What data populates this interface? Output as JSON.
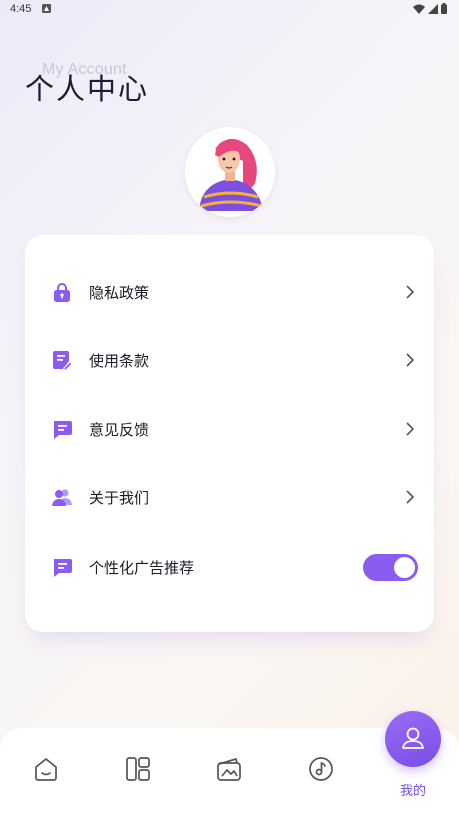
{
  "status_bar": {
    "time": "4:45"
  },
  "header": {
    "subtitle": "My Account",
    "title": "个人中心"
  },
  "menu": [
    {
      "label": "隐私政策",
      "icon": "lock-icon"
    },
    {
      "label": "使用条款",
      "icon": "document-edit-icon"
    },
    {
      "label": "意见反馈",
      "icon": "chat-feedback-icon"
    },
    {
      "label": "关于我们",
      "icon": "users-icon"
    }
  ],
  "personalized_ads": {
    "label": "个性化广告推荐",
    "icon": "chat-icon",
    "enabled": true
  },
  "tabs": {
    "items": [
      "home-icon",
      "layout-icon",
      "wallet-icon",
      "music-icon",
      "person-icon"
    ],
    "active_label": "我的"
  },
  "colors": {
    "accent": "#8A5CF0",
    "title": "#1C1B3A"
  }
}
